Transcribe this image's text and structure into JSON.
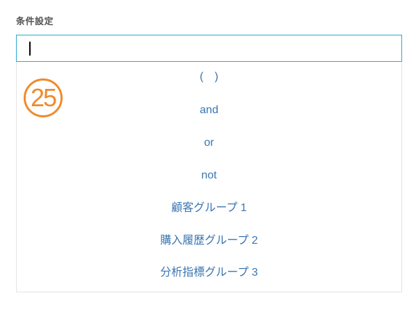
{
  "form": {
    "label": "条件設定",
    "input_value": ""
  },
  "dropdown": {
    "options": [
      "(　)",
      "and",
      "or",
      "not",
      "顧客グループ 1",
      "購入履歴グループ 2",
      "分析指標グループ 3"
    ]
  },
  "annotation": {
    "step_number": "25",
    "color": "#f08a2a"
  },
  "colors": {
    "accent_border": "#2aa7d1",
    "option_text": "#3a75b0"
  }
}
